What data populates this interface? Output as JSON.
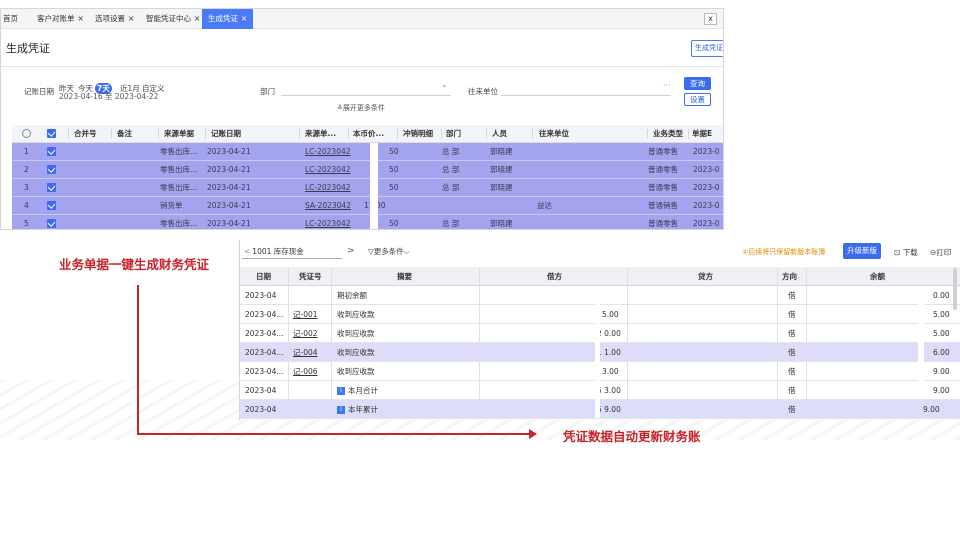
{
  "tabs": [
    {
      "label": "首页",
      "close": ""
    },
    {
      "label": "客户对账单",
      "close": "×"
    },
    {
      "label": "选项设置",
      "close": "×"
    },
    {
      "label": "智能凭证中心",
      "close": "×"
    },
    {
      "label": "生成凭证",
      "close": "×"
    }
  ],
  "window_close": "x",
  "page_title": "生成凭证",
  "generate_button": "生成凭证",
  "filters": {
    "date_label": "记账日期",
    "date_options": [
      "昨天",
      "今天",
      "7天",
      "近1月",
      "自定义"
    ],
    "selected_option": "7天",
    "date_range": "2023-04-16 至 2023-04-22",
    "dept_label": "部门",
    "partner_label": "往来单位",
    "more_conditions": "展开更多条件",
    "query_button": "查询",
    "settings_button": "设置"
  },
  "doc_table": {
    "headers": [
      "合并号",
      "备注",
      "来源单据",
      "记账日期",
      "来源单...",
      "本币价...",
      "冲销明细",
      "部门",
      "人员",
      "往来单位",
      "业务类型",
      "单据E"
    ],
    "rows": [
      {
        "idx": "1",
        "source": "零售出库...",
        "date": "2023-04-21",
        "no": "LC-2023042",
        "amount": "50",
        "dept": "总 部",
        "person": "郭晓建",
        "partner": "",
        "biz": "普通零售",
        "doc": "2023-0"
      },
      {
        "idx": "2",
        "source": "零售出库...",
        "date": "2023-04-21",
        "no": "LC-2023042",
        "amount": "50",
        "dept": "总 部",
        "person": "郭晓建",
        "partner": "",
        "biz": "普通零售",
        "doc": "2023-0"
      },
      {
        "idx": "3",
        "source": "零售出库...",
        "date": "2023-04-21",
        "no": "LC-2023042",
        "amount": "50",
        "dept": "总 部",
        "person": "郭晓建",
        "partner": "",
        "biz": "普通零售",
        "doc": "2023-0"
      },
      {
        "idx": "4",
        "source": "销货单",
        "date": "2023-04-21",
        "no": "SA-2023042",
        "amount": "11 00",
        "dept": "",
        "person": "",
        "partner": "益达",
        "biz": "普通销售",
        "doc": "2023-0"
      },
      {
        "idx": "5",
        "source": "零售出库...",
        "date": "2023-04-21",
        "no": "LC-2023042",
        "amount": "50",
        "dept": "总 部",
        "person": "郭晓建",
        "partner": "",
        "biz": "普通零售",
        "doc": "2023-0"
      }
    ]
  },
  "annotations": {
    "left": "业务单据一键生成财务凭证",
    "right": "凭证数据自动更新财务账"
  },
  "ledger": {
    "account_arrow": "<",
    "account": "1001 库存现金",
    "next_arrow": ">",
    "more_conditions": "更多条件",
    "notice": "①后续将只保留新版本账簿",
    "upgrade_button": "升级新版",
    "download": "下载",
    "print": "打印",
    "headers": [
      "日期",
      "凭证号",
      "摘要",
      "借方",
      "贷方",
      "方向",
      "余额"
    ],
    "rows": [
      {
        "date": "2023-04",
        "voucher": "",
        "summary": "期初余额",
        "badge": "",
        "debit": "",
        "credit": "",
        "dir": "借",
        "balance": "0.00"
      },
      {
        "date": "2023-04...",
        "voucher": "记-001",
        "summary": "收到应收款",
        "badge": "",
        "debit": "5.00",
        "credit": "",
        "dir": "借",
        "balance": "5.00"
      },
      {
        "date": "2023-04...",
        "voucher": "记-002",
        "summary": "收到应收款",
        "badge": "",
        "debit": "2 0.00",
        "credit": "",
        "dir": "借",
        "balance": "5.00"
      },
      {
        "date": "2023-04...",
        "voucher": "记-004",
        "summary": "收到应收款",
        "badge": "",
        "debit": "1 1.00",
        "credit": "",
        "dir": "借",
        "balance": "6.00"
      },
      {
        "date": "2023-04...",
        "voucher": "记-006",
        "summary": "收到应收款",
        "badge": "",
        "debit": "3.00",
        "credit": "",
        "dir": "借",
        "balance": "9.00"
      },
      {
        "date": "2023-04",
        "voucher": "",
        "summary": "本月合计",
        "badge": "i",
        "debit": "5 3.00",
        "credit": "",
        "dir": "借",
        "balance": "9.00"
      },
      {
        "date": "2023-04",
        "voucher": "",
        "summary": "本年累计",
        "badge": "i",
        "debit": "5 9.00",
        "credit": "",
        "dir": "借",
        "balance": "9.00"
      }
    ]
  },
  "colors": {
    "accent": "#3b6cf0",
    "row_highlight": "#a4a3ed",
    "annotation_red": "#c8232a",
    "notice_orange": "#e08a00"
  }
}
